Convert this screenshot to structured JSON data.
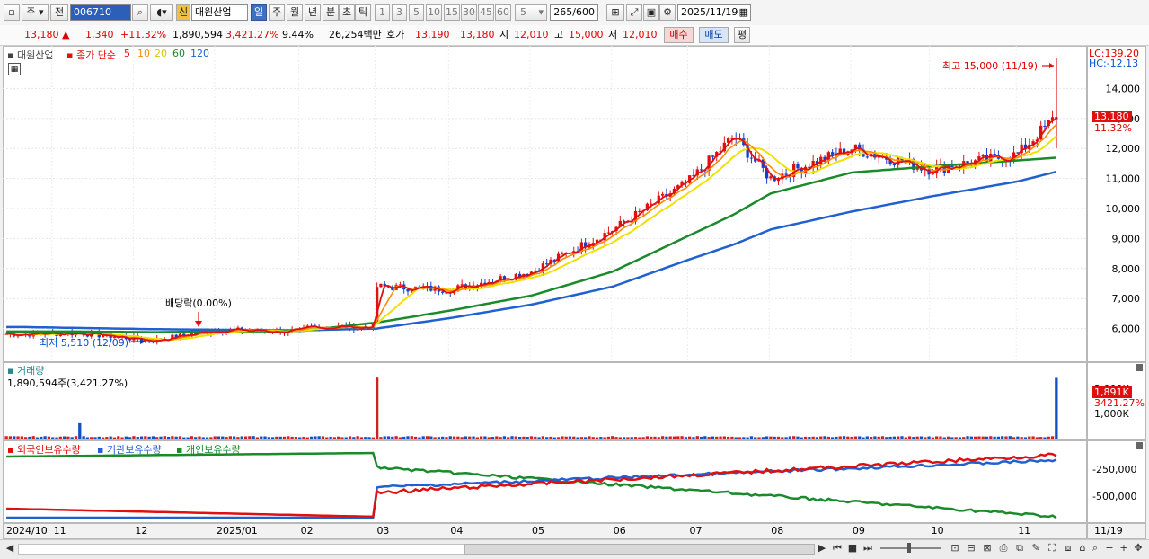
{
  "toolbar": {
    "period_a": "주",
    "prev_label": "전",
    "code": "006710",
    "badge": "신",
    "stock_name": "대원산업",
    "tab_day": "일",
    "tab_week": "주",
    "tab_month": "월",
    "tab_year": "년",
    "tab_min": "분",
    "tab_sec": "초",
    "tab_tick": "틱",
    "intervals": [
      "1",
      "3",
      "5",
      "10",
      "15",
      "30",
      "45",
      "60"
    ],
    "interval_value": "5",
    "count": "265",
    "count_total": "/600",
    "date": "2025/11/19"
  },
  "quote": {
    "price": "13,180",
    "change": "1,340",
    "change_pct": "+11.32%",
    "volume": "1,890,594",
    "volume_pct": "3,421.27%",
    "turnover": "9.44%",
    "amount": "26,254백만",
    "ask_label": "호가",
    "ask": "13,190",
    "bid": "13,180",
    "open_label": "시",
    "open": "12,010",
    "high_label": "고",
    "high": "15,000",
    "low_label": "저",
    "low": "12,010",
    "buy": "매수",
    "sell": "매도",
    "flat": "평"
  },
  "price_panel": {
    "legend_name": "대원산업",
    "legend_close": "종가 단순",
    "ma": [
      {
        "period": "5",
        "color": "#e01010"
      },
      {
        "period": "10",
        "color": "#ff8a00"
      },
      {
        "period": "20",
        "color": "#f0e000"
      },
      {
        "period": "60",
        "color": "#1a8a2a"
      },
      {
        "period": "120",
        "color": "#2060d0"
      }
    ],
    "lc": "LC:139.20",
    "hc": "HC:-12.13",
    "high_note": "최고 15,000 (11/19)",
    "low_note": "최저 5,510 (12/09)",
    "dividend_note": "배당락(0.00%)",
    "last_price": "13,180",
    "last_pct": "11.32%"
  },
  "volume_panel": {
    "title": "거래량",
    "value": "1,890,594주(3,421.27%)",
    "tag_value": "1,891K",
    "tag_pct": "3421.27%",
    "ticks": [
      "2,000K",
      "1,000K"
    ]
  },
  "holder_panel": {
    "legend": [
      {
        "name": "외국인보유수량",
        "color": "#e01010"
      },
      {
        "name": "기관보유수량",
        "color": "#2060d0"
      },
      {
        "name": "개인보유수량",
        "color": "#1a8a2a"
      }
    ],
    "ticks": [
      "-250,000",
      "-500,000"
    ]
  },
  "date_axis": {
    "labels": [
      "2024/10",
      "11",
      "12",
      "2025/01",
      "02",
      "03",
      "04",
      "05",
      "06",
      "07",
      "08",
      "09",
      "10",
      "11"
    ],
    "right_label": "11/19"
  },
  "chart_data": {
    "type": "candlestick",
    "x": [
      "2024-10-21",
      "2024-11-11",
      "2024-12-09",
      "2025-01-02",
      "2025-02-03",
      "2025-03-04",
      "2025-04-01",
      "2025-05-02",
      "2025-06-02",
      "2025-07-01",
      "2025-07-18",
      "2025-08-01",
      "2025-09-01",
      "2025-10-01",
      "2025-11-03",
      "2025-11-19"
    ],
    "close": [
      5820,
      5850,
      5600,
      5950,
      5900,
      7400,
      7300,
      7900,
      9300,
      10900,
      12400,
      11000,
      12000,
      11300,
      11800,
      13180
    ],
    "ylim": [
      5000,
      15300
    ],
    "yticks": [
      6000,
      7000,
      8000,
      9000,
      10000,
      11000,
      12000,
      13000,
      14000
    ],
    "ma120": [
      6050,
      6020,
      5980,
      5960,
      5940,
      6000,
      6350,
      6800,
      7400,
      8300,
      8800,
      9300,
      9900,
      10400,
      10900,
      11250
    ],
    "ma60": [
      5900,
      5900,
      5880,
      5900,
      5920,
      6200,
      6600,
      7100,
      7900,
      9100,
      9800,
      10500,
      11200,
      11400,
      11600,
      11700
    ],
    "volume_spikes": [
      {
        "x": "2024-11-11",
        "v": 480
      },
      {
        "x": "2025-03-04",
        "v": 1900
      },
      {
        "x": "2025-11-19",
        "v": 1891
      }
    ]
  },
  "bottom": {
    "scroll": "◀"
  }
}
